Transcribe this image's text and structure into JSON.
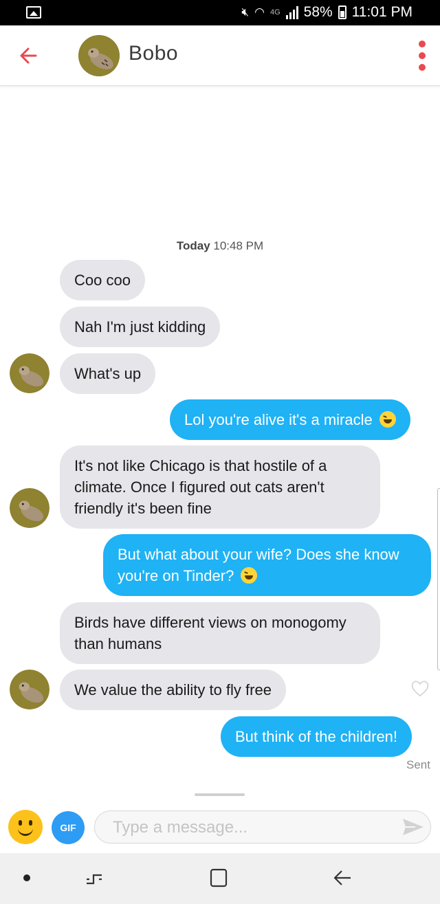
{
  "status_bar": {
    "network": "4G",
    "battery": "58%",
    "time": "11:01 PM",
    "icons": [
      "gallery-icon",
      "mute-icon",
      "wifi-icon",
      "signal-icon",
      "battery-icon"
    ]
  },
  "header": {
    "contact_name": "Bobo",
    "back_icon": "back-arrow-icon",
    "menu_icon": "kebab-menu-icon",
    "accent_color": "#e9494f"
  },
  "conversation": {
    "timestamp_day": "Today",
    "timestamp_time": "10:48 PM",
    "messages": [
      {
        "from": "them",
        "text": "Coo coo"
      },
      {
        "from": "them",
        "text": "Nah I'm just kidding"
      },
      {
        "from": "them",
        "text": "What's up"
      },
      {
        "from": "me",
        "text": "Lol you're alive it's a miracle",
        "emoji": "laughing-emoji"
      },
      {
        "from": "them",
        "text": "It's not like Chicago is that hostile of a climate. Once I figured out cats aren't friendly it's been fine"
      },
      {
        "from": "me",
        "text": "But what about your wife? Does she know you're on Tinder?",
        "emoji": "laughing-emoji"
      },
      {
        "from": "them",
        "text": "Birds have different views on monogomy than humans"
      },
      {
        "from": "them",
        "text": "We value the ability to fly free"
      },
      {
        "from": "me",
        "text": "But think of the children!"
      }
    ],
    "sent_status": "Sent",
    "sent_bubble_color": "#1fb2f5",
    "received_bubble_color": "#e5e5ea"
  },
  "composer": {
    "gif_label": "GIF",
    "placeholder": "Type a message...",
    "emoji_button_icon": "smiley-icon",
    "send_icon": "send-icon"
  },
  "nav_bar": {
    "icons": [
      "dot-icon",
      "recent-apps-icon",
      "home-icon",
      "back-icon"
    ]
  }
}
